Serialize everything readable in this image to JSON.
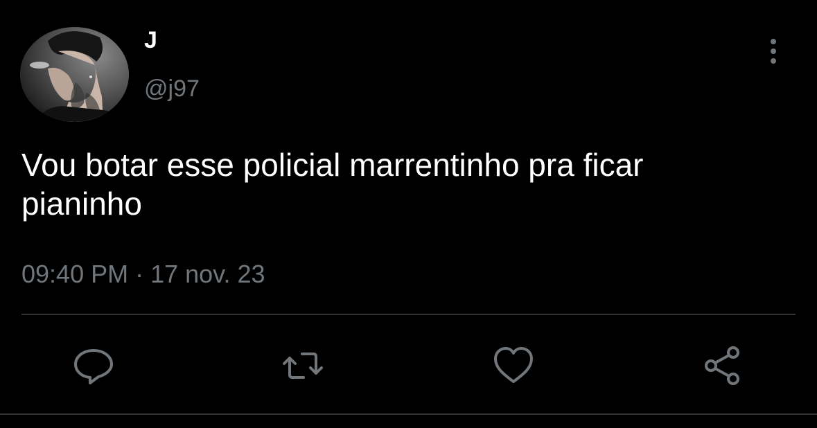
{
  "user": {
    "display_name": "J",
    "handle": "@j97"
  },
  "tweet": {
    "text": "Vou botar esse policial marrentinho pra ficar\npianinho",
    "time": "09:40 PM",
    "separator": " · ",
    "date": "17 nov. 23"
  },
  "actions": [
    {
      "name": "reply",
      "icon": "comment-icon"
    },
    {
      "name": "retweet",
      "icon": "retweet-icon"
    },
    {
      "name": "like",
      "icon": "heart-icon"
    },
    {
      "name": "share",
      "icon": "share-icon"
    }
  ],
  "colors": {
    "background": "#000000",
    "primary_text": "#ffffff",
    "secondary_text": "#71767b",
    "divider": "#2f3336"
  }
}
